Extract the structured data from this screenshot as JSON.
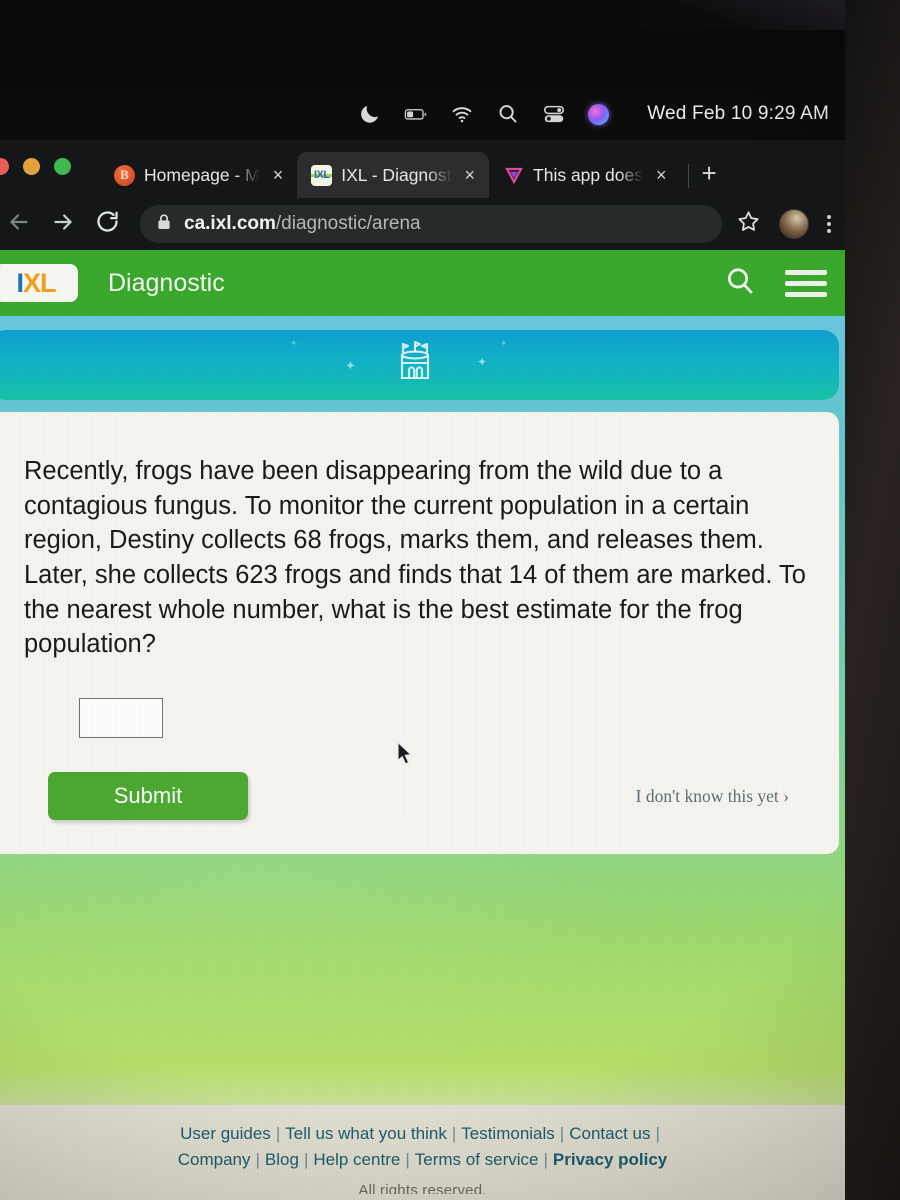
{
  "menubar": {
    "icons": [
      "moon-icon",
      "battery-icon",
      "wifi-icon",
      "search-icon",
      "control-center-icon",
      "siri-icon"
    ],
    "clock": "Wed Feb 10  9:29 AM"
  },
  "browser": {
    "window_controls": [
      "close",
      "minimize",
      "zoom"
    ],
    "tabs": [
      {
        "favicon": "brightspace-icon",
        "title": "Homepage - M",
        "close_label": "×",
        "active": false
      },
      {
        "favicon": "ixl-icon",
        "title": "IXL - Diagnost",
        "close_label": "×",
        "active": true
      },
      {
        "favicon": "vector-v-icon",
        "title": "This app does",
        "close_label": "×",
        "active": false
      }
    ],
    "new_tab_label": "+",
    "back_label": "←",
    "forward_label": "→",
    "reload_label": "⟳",
    "address": {
      "domain": "ca.ixl.com",
      "path": "/diagnostic/arena",
      "lock": "lock-icon"
    },
    "bookmark_label": "☆",
    "menu_label": "kebab-menu-icon"
  },
  "site": {
    "logo": {
      "i": "I",
      "xl": "XL"
    },
    "header_title": "Diagnostic",
    "search_icon": "search-icon",
    "menu_icon": "hamburger-menu-icon",
    "banner": {
      "icon": "arena-castle-icon",
      "sparkles": [
        "✦",
        "✦",
        "✦",
        "✦"
      ]
    },
    "question": "Recently, frogs have been disappearing from the wild due to a contagious fungus. To monitor the current population in a certain region, Destiny collects 68 frogs, marks them, and releases them. Later, she collects 623 frogs and finds that 14 of them are marked. To the nearest whole number, what is the best estimate for the frog population?",
    "answer_value": "",
    "answer_placeholder": "",
    "submit_label": "Submit",
    "dont_know_label": "I don't know this yet ›"
  },
  "footer": {
    "row1": [
      {
        "label": "User guides",
        "bold": false
      },
      {
        "label": "Tell us what you think",
        "bold": false
      },
      {
        "label": "Testimonials",
        "bold": false
      },
      {
        "label": "Contact us",
        "bold": false
      }
    ],
    "row2_left": [
      {
        "label": "Company",
        "bold": false
      },
      {
        "label": "Blog",
        "bold": false
      },
      {
        "label": "Help centre",
        "bold": false
      }
    ],
    "row2_right": [
      {
        "label": "Terms of service",
        "bold": false
      },
      {
        "label": "Privacy policy",
        "bold": true
      }
    ],
    "separator": "|",
    "copyright": "All rights reserved."
  },
  "colors": {
    "ixl_green": "#3aa82d",
    "submit_green": "#46a62c",
    "banner_teal": "#12b1c6",
    "link_teal": "#1d5c6e",
    "logo_blue": "#1d6fb8",
    "logo_orange": "#f0a11b"
  }
}
